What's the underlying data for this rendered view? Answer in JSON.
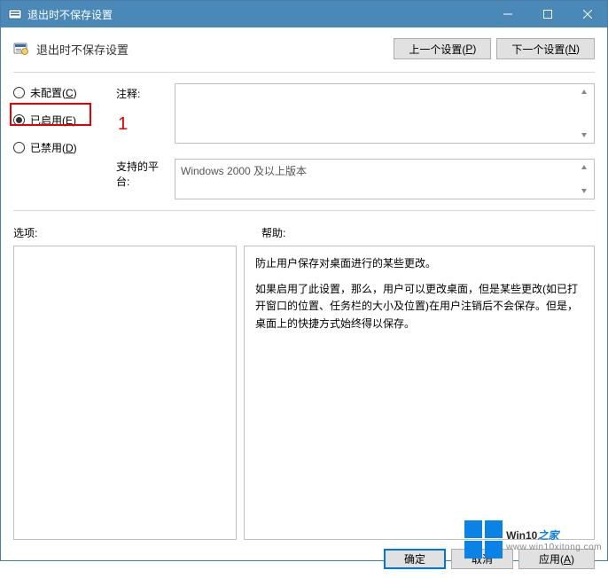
{
  "window": {
    "title": "退出时不保存设置"
  },
  "header": {
    "title": "退出时不保存设置",
    "prev_btn_prefix": "上一个设置(",
    "prev_btn_key": "P",
    "prev_btn_suffix": ")",
    "next_btn_prefix": "下一个设置(",
    "next_btn_key": "N",
    "next_btn_suffix": ")"
  },
  "radios": {
    "not_configured_prefix": "未配置(",
    "not_configured_key": "C",
    "not_configured_suffix": ")",
    "enabled_prefix": "已启用(",
    "enabled_key": "E",
    "enabled_suffix": ")",
    "disabled_prefix": "已禁用(",
    "disabled_key": "D",
    "disabled_suffix": ")"
  },
  "labels": {
    "comment": "注释:",
    "supported_platform": "支持的平台:",
    "options": "选项:",
    "help": "帮助:"
  },
  "platform": {
    "value": "Windows 2000 及以上版本"
  },
  "help_text": {
    "p1": "防止用户保存对桌面进行的某些更改。",
    "p2": "如果启用了此设置，那么，用户可以更改桌面，但是某些更改(如已打开窗口的位置、任务栏的大小及位置)在用户注销后不会保存。但是，桌面上的快捷方式始终得以保存。"
  },
  "buttons": {
    "ok": "确定",
    "cancel": "取消",
    "apply_prefix": "应用(",
    "apply_key": "A",
    "apply_suffix": ")"
  },
  "annotation": {
    "number": "1"
  },
  "watermark": {
    "brand_main": "Win10",
    "brand_suffix": "之家",
    "url": "www.win10xitong.com"
  }
}
